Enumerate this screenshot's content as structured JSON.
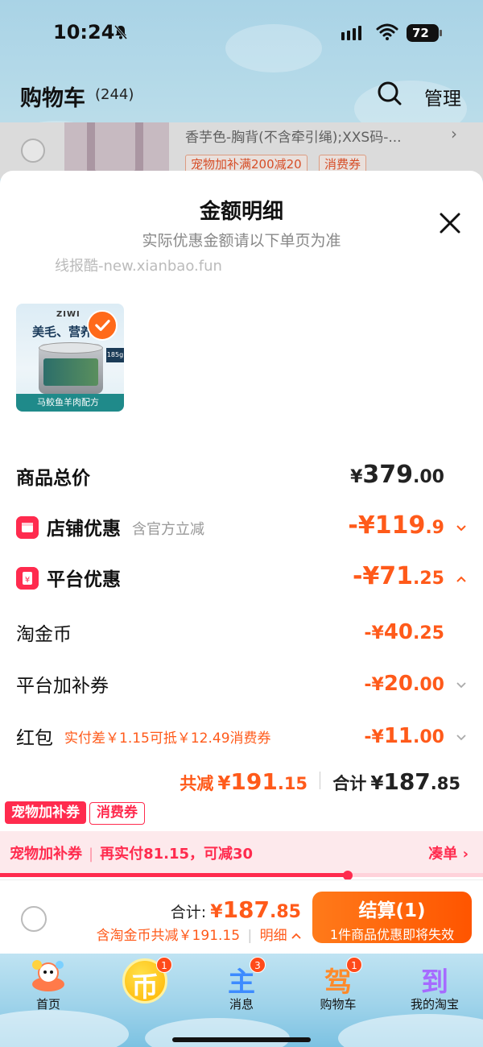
{
  "status_bar": {
    "time": "10:24",
    "battery": "72"
  },
  "cart_header": {
    "title": "购物车",
    "count": "(244)",
    "manage_label": "管理"
  },
  "background_item": {
    "spec": "香芋色-胸背(不含牵引绳);XXS码-...",
    "tags": [
      "宠物加补满200减20",
      "消费券"
    ]
  },
  "sheet": {
    "title": "金额明细",
    "subtitle": "实际优惠金额请以下单页为准",
    "watermark": "线报酷-new.xianbao.fun",
    "product": {
      "brand": "ZIWI",
      "headline": "美毛、营养供",
      "weight": "185g",
      "footer": "马鲛鱼羊肉配方"
    },
    "rows": {
      "subtotal": {
        "label": "商品总价",
        "currency": "¥",
        "int": "379",
        "dec": ".00"
      },
      "shop": {
        "label": "店铺优惠",
        "note": "含官方立减",
        "prefix": "-¥",
        "int": "119",
        "dec": ".9"
      },
      "platform": {
        "label": "平台优惠",
        "prefix": "-¥",
        "int": "71",
        "dec": ".25"
      },
      "coins": {
        "label": "淘金币",
        "prefix": "-¥",
        "int": "40",
        "dec": ".25"
      },
      "coupon": {
        "label": "平台加补券",
        "prefix": "-¥",
        "int": "20",
        "dec": ".00"
      },
      "redpacket": {
        "label": "红包",
        "note": "实付差￥1.15可抵￥12.49消费券",
        "prefix": "-¥",
        "int": "11",
        "dec": ".00"
      }
    },
    "summary": {
      "saved_label": "共减",
      "saved_sym": "¥",
      "saved_int": "191",
      "saved_dec": ".15",
      "total_label": "合计",
      "total_sym": "¥",
      "total_int": "187",
      "total_dec": ".85"
    },
    "pills": [
      "宠物加补券",
      "消费券"
    ],
    "promo": {
      "left_a": "宠物加补券",
      "left_b": "再实付81.15，可减30",
      "right": "凑单",
      "progress_fraction": 0.72
    }
  },
  "bottom_bar": {
    "total_label": "合计:",
    "total_sym": "¥",
    "total_int": "187",
    "total_dec": ".85",
    "note": "含淘金币共减￥191.15",
    "detail_label": "明细",
    "checkout_label": "结算(1)",
    "checkout_sub": "1件商品优惠即将失效"
  },
  "tab_bar": {
    "tabs": [
      {
        "label": "首页",
        "badge": ""
      },
      {
        "label": "",
        "badge": "1",
        "glyph": "币"
      },
      {
        "label": "消息",
        "badge": "3",
        "glyph": "主"
      },
      {
        "label": "购物车",
        "badge": "1",
        "glyph": "驾"
      },
      {
        "label": "我的淘宝",
        "badge": "",
        "glyph": "到"
      }
    ]
  },
  "colors": {
    "accent": "#ff5a1a",
    "promo_red": "#ff2b4e",
    "checkout_start": "#ff7a1a",
    "checkout_end": "#ff5500"
  }
}
